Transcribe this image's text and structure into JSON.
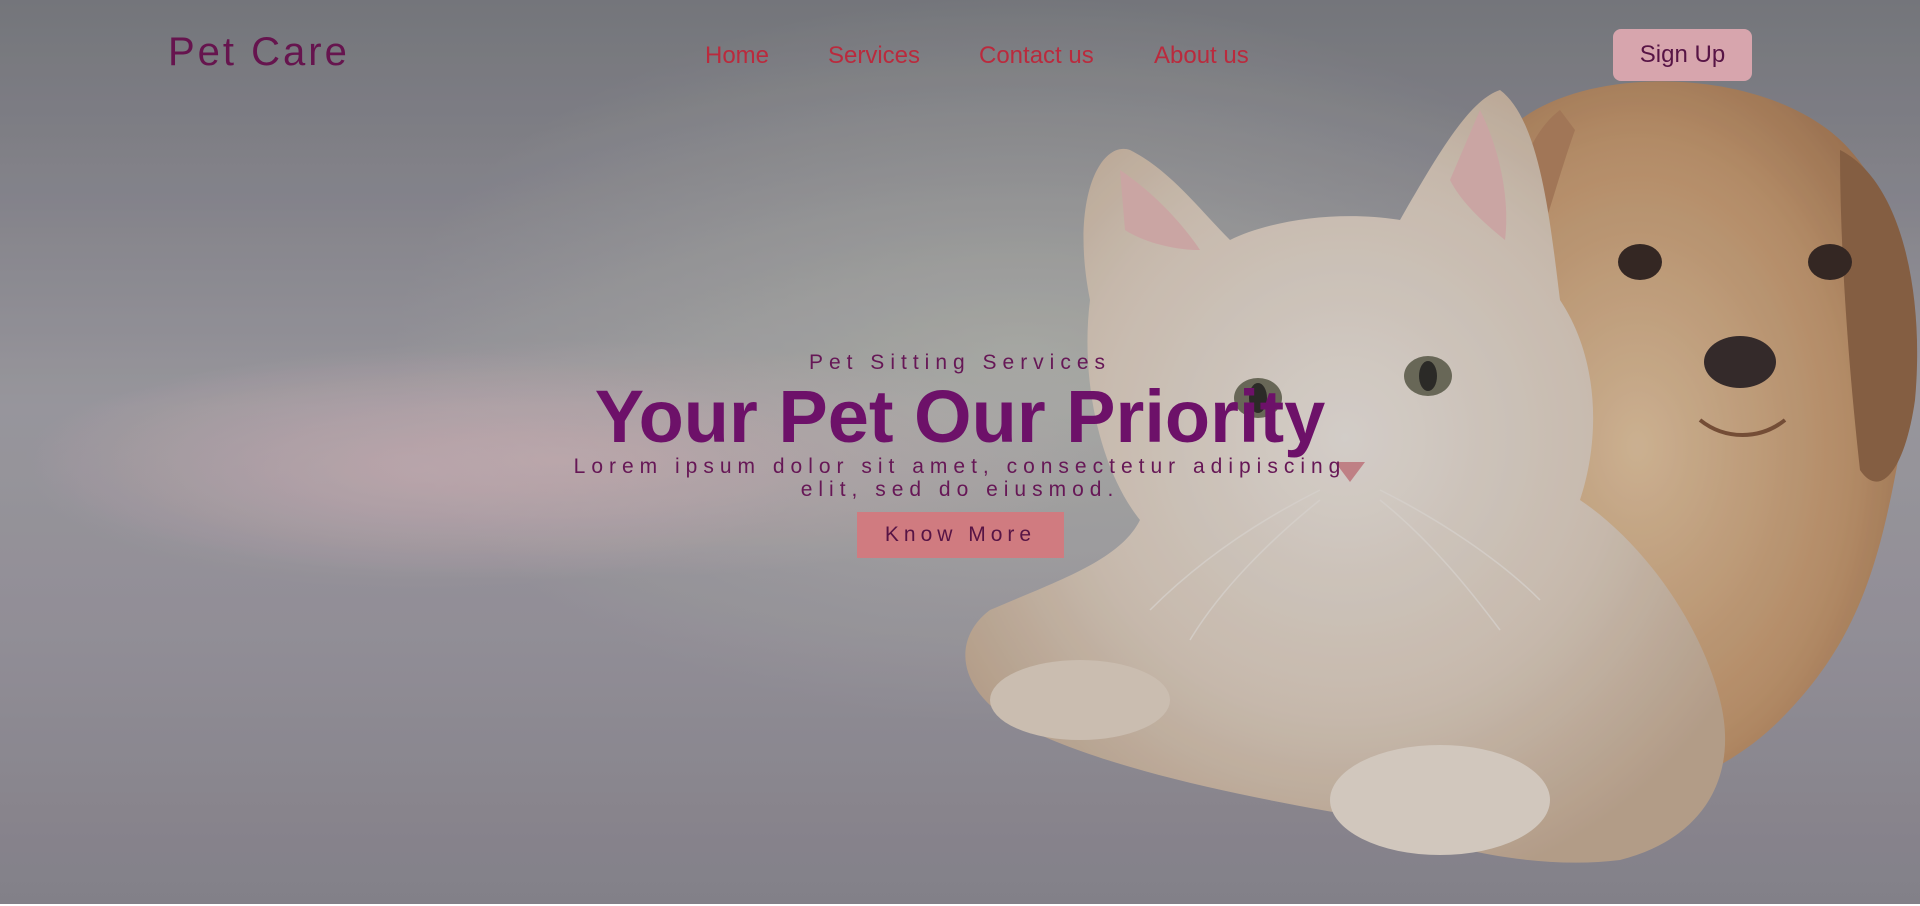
{
  "header": {
    "brand": "Pet Care",
    "nav": {
      "home": "Home",
      "services": "Services",
      "contact": "Contact us",
      "about": "About us"
    },
    "signup_label": "Sign Up"
  },
  "hero": {
    "subtitle": "Pet Sitting Services",
    "headline": "Your Pet Our Priority",
    "description_line1": "Lorem ipsum dolor sit amet, consectetur adipiscing",
    "description_line2": "elit, sed do eiusmod.",
    "cta_label": "Know More",
    "image": "kitten-and-puppy-photo"
  },
  "colors": {
    "brand_text": "#6a0f4e",
    "nav_link": "#c8283c",
    "signup_bg": "#e8b0b8",
    "headline": "#720c6c",
    "cta_bg": "#e08286"
  }
}
